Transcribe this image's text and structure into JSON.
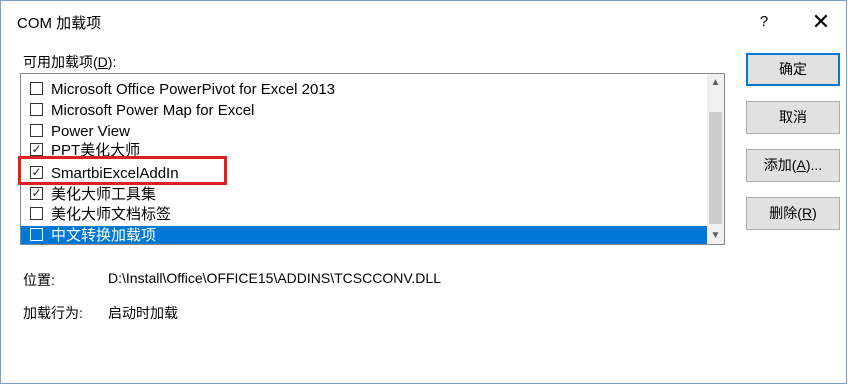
{
  "dialog": {
    "title": "COM 加载项",
    "help_label": "?",
    "close_label": "✕"
  },
  "list": {
    "label_prefix": "可用加载项(",
    "label_accel": "D",
    "label_suffix": "):",
    "items": [
      {
        "label": "Microsoft Office PowerPivot for Excel 2013",
        "checked": false,
        "selected": false
      },
      {
        "label": "Microsoft Power Map for Excel",
        "checked": false,
        "selected": false
      },
      {
        "label": "Power View",
        "checked": false,
        "selected": false
      },
      {
        "label": "PPT美化大师",
        "checked": true,
        "selected": false
      },
      {
        "label": "SmartbiExcelAddIn",
        "checked": true,
        "selected": false
      },
      {
        "label": "美化大师工具集",
        "checked": true,
        "selected": false
      },
      {
        "label": "美化大师文档标签",
        "checked": false,
        "selected": false
      },
      {
        "label": "中文转换加载项",
        "checked": false,
        "selected": true
      }
    ]
  },
  "buttons": {
    "ok": "确定",
    "cancel": "取消",
    "add_prefix": "添加(",
    "add_accel": "A",
    "add_suffix": ")...",
    "remove_prefix": "删除(",
    "remove_accel": "R",
    "remove_suffix": ")"
  },
  "info": {
    "location_label": "位置:",
    "location_value": "D:\\Install\\Office\\OFFICE15\\ADDINS\\TCSCCONV.DLL",
    "load_behavior_label": "加载行为:",
    "load_behavior_value": "启动时加载"
  },
  "colors": {
    "selection": "#0078d7",
    "highlight_box": "#e02020"
  }
}
